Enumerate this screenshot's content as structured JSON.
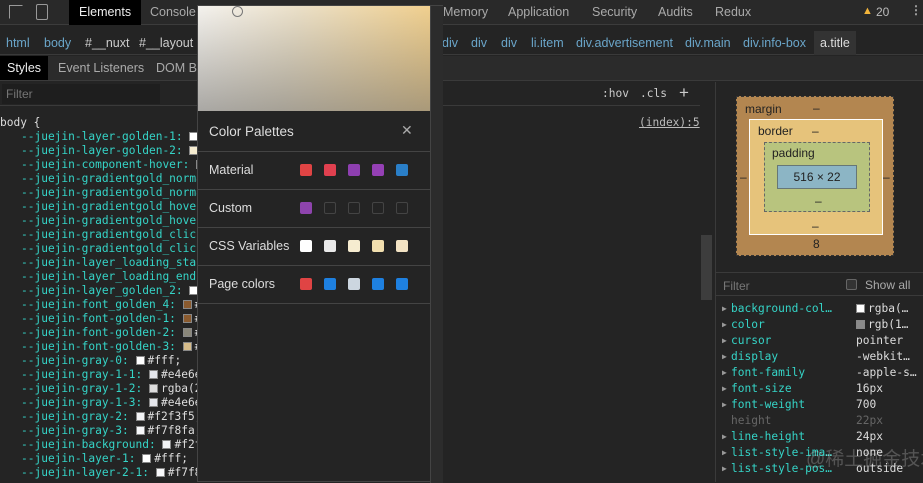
{
  "toolbar": {
    "tabs": [
      "Elements",
      "Console",
      "Memory",
      "Application",
      "Security",
      "Audits",
      "Redux"
    ],
    "warnings": "20"
  },
  "breadcrumb": [
    "html",
    "body",
    "#__nuxt",
    "#__layout",
    "div",
    "div",
    "div",
    "li.item",
    "div.advertisement",
    "div.main",
    "div.info-box",
    "a.title"
  ],
  "subtabs": [
    "Styles",
    "Event Listeners",
    "DOM B"
  ],
  "styles": {
    "filter_placeholder": "Filter",
    "hov": ":hov",
    "cls": ".cls",
    "add": "+",
    "source": "(index):5",
    "selector": "body {",
    "lines": [
      {
        "p": "--juejin-layer-golden-1:",
        "c": "#ffffff",
        "v": ""
      },
      {
        "p": "--juejin-layer-golden-2:",
        "c": "#f6ecd0",
        "v": ""
      },
      {
        "p": "--juejin-component-hover:",
        "c": "#eeeeee",
        "v": ""
      },
      {
        "p": "--juejin-gradientgold_norma",
        "c": "",
        "v": ""
      },
      {
        "p": "--juejin-gradientgold_norma",
        "c": "",
        "v": ""
      },
      {
        "p": "--juejin-gradientgold_hover",
        "c": "",
        "v": ""
      },
      {
        "p": "--juejin-gradientgold_hover",
        "c": "",
        "v": ""
      },
      {
        "p": "--juejin-gradientgold_click",
        "c": "",
        "v": ""
      },
      {
        "p": "--juejin-gradientgold_click",
        "c": "",
        "v": ""
      },
      {
        "p": "--juejin-layer_loading_star",
        "c": "",
        "v": ""
      },
      {
        "p": "--juejin-layer_loading_end:",
        "c": "",
        "v": ""
      },
      {
        "p": "--juejin-layer_golden_2:",
        "c": "#ffffff",
        "v": ""
      },
      {
        "p": "--juejin-font_golden_4:",
        "c": "#8a5a2e",
        "v": "#"
      },
      {
        "p": "--juejin-font-golden-1:",
        "c": "#8a5a2e",
        "v": "#"
      },
      {
        "p": "--juejin-font-golden-2:",
        "c": "#8a877a",
        "v": "#"
      },
      {
        "p": "--juejin-font-golden-3:",
        "c": "#d6bc8a",
        "v": "#"
      },
      {
        "p": "--juejin-gray-0:",
        "c": "#ffffff",
        "v": "#fff;"
      },
      {
        "p": "--juejin-gray-1-1:",
        "c": "#e4e6eb",
        "v": "#e4e6e"
      },
      {
        "p": "--juejin-gray-1-2:",
        "c": "#dddddd",
        "v": "rgba(2"
      },
      {
        "p": "--juejin-gray-1-3:",
        "c": "#e4e6eb",
        "v": "#e4e6e"
      },
      {
        "p": "--juejin-gray-2:",
        "c": "#f2f3f5",
        "v": "#f2f3f5;"
      },
      {
        "p": "--juejin-gray-3:",
        "c": "#f7f8fa",
        "v": "#f7f8fa;"
      },
      {
        "p": "--juejin-background:",
        "c": "#f2f3f5",
        "v": "#f2f"
      },
      {
        "p": "--juejin-layer-1:",
        "c": "#ffffff",
        "v": "#fff;"
      },
      {
        "p": "--juejin-layer-2-1:",
        "c": "#f7f8fa",
        "v": "#f7f8"
      }
    ]
  },
  "palette": {
    "title": "Color Palettes",
    "close": "✕",
    "rows": [
      {
        "label": "Material",
        "colors": [
          "#e04444",
          "#e0404f",
          "#8e3fb0",
          "#9540b5",
          "#2a7fc8"
        ]
      },
      {
        "label": "Custom",
        "colors": [
          "#8e44ad",
          "",
          "",
          "",
          ""
        ]
      },
      {
        "label": "CSS Variables",
        "colors": [
          "#ffffff",
          "#e9e9e9",
          "#f6ecd0",
          "#f2dfaf",
          "#f3e3c4"
        ]
      },
      {
        "label": "Page colors",
        "colors": [
          "#e04444",
          "#1e80e0",
          "#ccd6e0",
          "#1e80e0",
          "#1e80e0"
        ]
      }
    ]
  },
  "boxmodel": {
    "margin": "margin",
    "border": "border",
    "padding": "padding",
    "content": "516 × 22",
    "dash": "–",
    "margin_bottom": "8"
  },
  "computed": {
    "filter": "Filter",
    "show_all": "Show all",
    "props": [
      {
        "n": "background-col…",
        "v": "rgba(…",
        "sw": "#ffffff"
      },
      {
        "n": "color",
        "v": "rgb(1…",
        "sw": "#8a8a8a"
      },
      {
        "n": "cursor",
        "v": "pointer"
      },
      {
        "n": "display",
        "v": "-webkit…"
      },
      {
        "n": "font-family",
        "v": "-apple-s…"
      },
      {
        "n": "font-size",
        "v": "16px"
      },
      {
        "n": "font-weight",
        "v": "700"
      },
      {
        "n": "height",
        "v": "22px",
        "dim": true
      },
      {
        "n": "line-height",
        "v": "24px"
      },
      {
        "n": "list-style-ima…",
        "v": "none"
      },
      {
        "n": "list-style-pos…",
        "v": "outside"
      }
    ]
  },
  "watermark": "@稀土掘金技术社区"
}
